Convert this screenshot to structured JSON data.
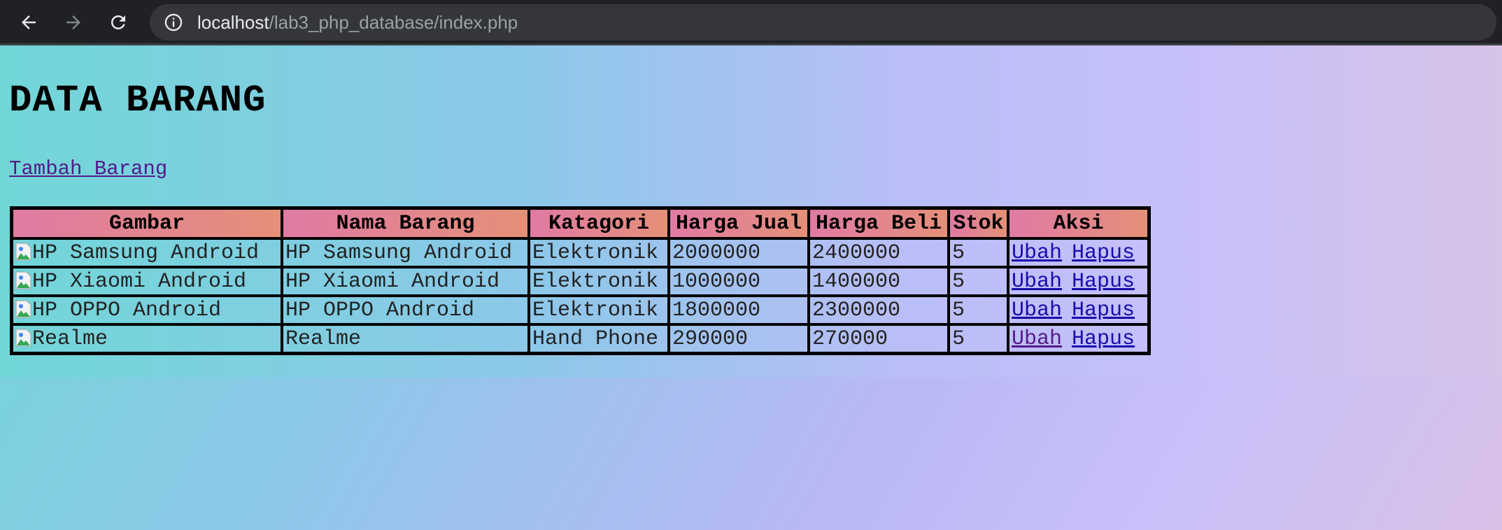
{
  "browser": {
    "url_host": "localhost",
    "url_path": "/lab3_php_database/index.php"
  },
  "page": {
    "title": "DATA BARANG",
    "add_link": "Tambah Barang"
  },
  "table": {
    "headers": [
      "Gambar",
      "Nama Barang",
      "Katagori",
      "Harga Jual",
      "Harga Beli",
      "Stok",
      "Aksi"
    ],
    "rows": [
      {
        "gambar_alt": "HP Samsung Android",
        "nama": "HP Samsung Android",
        "kategori": "Elektronik",
        "harga_jual": "2000000",
        "harga_beli": "2400000",
        "stok": "5",
        "ubah": "Ubah",
        "hapus": "Hapus"
      },
      {
        "gambar_alt": "HP Xiaomi Android",
        "nama": "HP Xiaomi Android",
        "kategori": "Elektronik",
        "harga_jual": "1000000",
        "harga_beli": "1400000",
        "stok": "5",
        "ubah": "Ubah",
        "hapus": "Hapus"
      },
      {
        "gambar_alt": "HP OPPO Android",
        "nama": "HP OPPO Android",
        "kategori": "Elektronik",
        "harga_jual": "1800000",
        "harga_beli": "2300000",
        "stok": "5",
        "ubah": "Ubah",
        "hapus": "Hapus"
      },
      {
        "gambar_alt": "Realme",
        "nama": "Realme",
        "kategori": "Hand Phone",
        "harga_jual": "290000",
        "harga_beli": "270000",
        "stok": "5",
        "ubah": "Ubah",
        "hapus": "Hapus"
      }
    ]
  }
}
